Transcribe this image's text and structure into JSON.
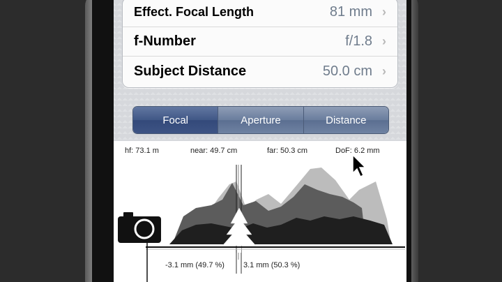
{
  "settings": {
    "rows": [
      {
        "label": "Effect. Focal Length",
        "value": "81 mm"
      },
      {
        "label": "f-Number",
        "value": "f/1.8"
      },
      {
        "label": "Subject Distance",
        "value": "50.0 cm"
      }
    ],
    "chevron": "›"
  },
  "segment": {
    "options": [
      "Focal",
      "Aperture",
      "Distance"
    ],
    "selected": "Focal"
  },
  "readouts": {
    "hf": "hf: 73.1 m",
    "near": "near: 49.7 cm",
    "far": "far: 50.3 cm",
    "dof": "DoF: 6.2 mm"
  },
  "bottom": {
    "near_offset": "-3.1 mm (49.7 %)",
    "far_offset": "3.1 mm (50.3 %)"
  },
  "colors": {
    "accent": "#405786",
    "value_text": "#6f7c8c"
  }
}
